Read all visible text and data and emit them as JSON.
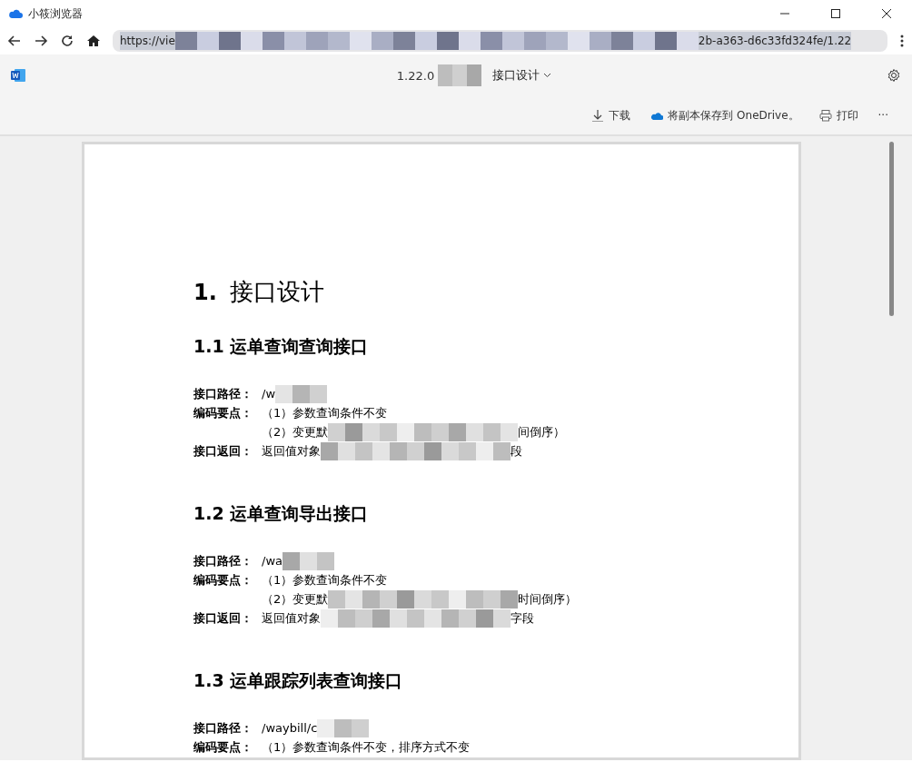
{
  "window": {
    "title": "小筱浏览器"
  },
  "address_bar": {
    "url_start": "https://vie",
    "url_hidden": true,
    "url_end": "2b-a363-d6c33fd324fe/1.22"
  },
  "doc_header": {
    "file_version": "1.22.0",
    "name_hidden": true,
    "title": "接口设计"
  },
  "commands": [
    {
      "kind": "download",
      "label": "下载"
    },
    {
      "kind": "onedrive",
      "label": "将副本保存到 OneDrive。"
    },
    {
      "kind": "print",
      "label": "打印"
    },
    {
      "kind": "more",
      "label": "···"
    }
  ],
  "document": {
    "heading": "1.",
    "heading_text": "接口设计",
    "sections": [
      {
        "heading": "1.1 运单查询查询接口",
        "lines": [
          {
            "label": "接口路径：",
            "text": "/w",
            "hidden": true
          },
          {
            "label": "编码要点：",
            "text": "（1）参数查询条件不变",
            "hidden": false
          },
          {
            "text": "（2）变更默",
            "hidden": true,
            "tail": "间倒序）"
          },
          {
            "label": "接口返回：",
            "text": "返回值对象",
            "hidden": true,
            "tail": "段"
          }
        ]
      },
      {
        "heading": "1.2 运单查询导出接口",
        "lines": [
          {
            "label": "接口路径：",
            "text": "/wa",
            "hidden": true
          },
          {
            "label": "编码要点：",
            "text": "（1）参数查询条件不变",
            "hidden": false
          },
          {
            "text": "（2）变更默",
            "hidden": true,
            "tail": "时间倒序）"
          },
          {
            "label": "接口返回：",
            "text": "返回值对象",
            "hidden": true,
            "tail": "字段"
          }
        ]
      },
      {
        "heading": "1.3 运单跟踪列表查询接口",
        "lines": [
          {
            "label": "接口路径：",
            "text": "/waybill/c",
            "hidden": true
          },
          {
            "label": "编码要点：",
            "text": "（1）参数查询条件不变，排序方式不变",
            "hidden": false
          }
        ]
      }
    ]
  }
}
